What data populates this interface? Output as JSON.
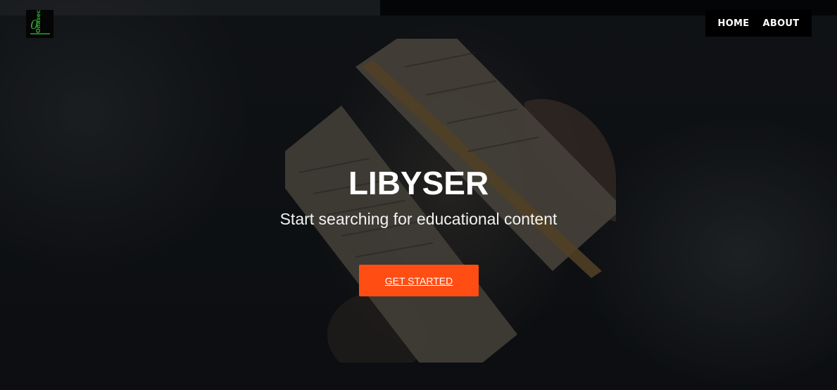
{
  "brand": {
    "logo_text": "Onasec",
    "logo_color": "#2fa52f"
  },
  "nav": {
    "items": [
      {
        "label": "HOME"
      },
      {
        "label": "ABOUT"
      }
    ]
  },
  "hero": {
    "title": "LIBYSER",
    "subtitle": "Start searching for educational content",
    "cta_label": "GET STARTED",
    "cta_color": "#ff4d14"
  }
}
